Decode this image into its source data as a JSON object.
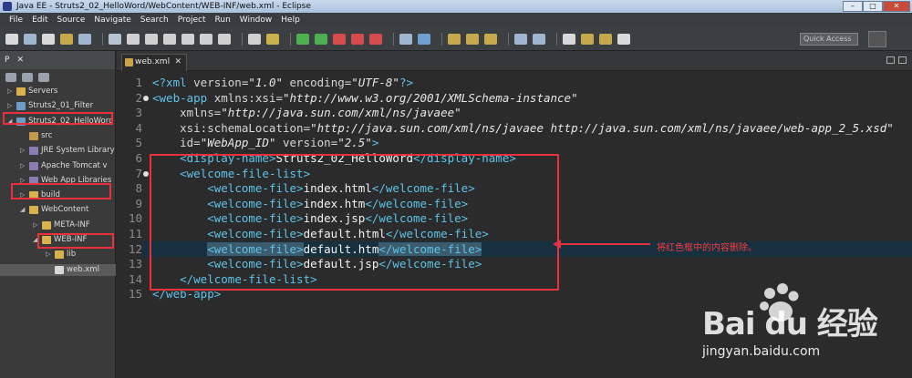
{
  "window": {
    "title": "Java EE - Struts2_02_HelloWord/WebContent/WEB-INF/web.xml - Eclipse",
    "controls": [
      "–",
      "□",
      "✕"
    ]
  },
  "menubar": [
    "File",
    "Edit",
    "Source",
    "Navigate",
    "Search",
    "Project",
    "Run",
    "Window",
    "Help"
  ],
  "toolbar": {
    "quick_access_placeholder": "Quick Access"
  },
  "left_panel": {
    "tabs": [
      "P",
      "✕"
    ],
    "tree": [
      {
        "label": "Servers",
        "depth": 0,
        "expanded": false,
        "icon": "folder",
        "color": "#d9b24b"
      },
      {
        "label": "Struts2_01_Filter",
        "depth": 0,
        "expanded": false,
        "icon": "project",
        "color": "#6d9cc7"
      },
      {
        "label": "Struts2_02_HelloWord",
        "depth": 0,
        "expanded": true,
        "icon": "project",
        "color": "#6d9cc7"
      },
      {
        "label": "src",
        "depth": 1,
        "expanded": null,
        "icon": "package",
        "color": "#c79a4a"
      },
      {
        "label": "JRE System Library",
        "depth": 1,
        "expanded": false,
        "icon": "library",
        "color": "#8c7bb5"
      },
      {
        "label": "Apache Tomcat v",
        "depth": 1,
        "expanded": false,
        "icon": "library",
        "color": "#8c7bb5"
      },
      {
        "label": "Web App Libraries",
        "depth": 1,
        "expanded": false,
        "icon": "library",
        "color": "#8c7bb5"
      },
      {
        "label": "build",
        "depth": 1,
        "expanded": false,
        "icon": "folder",
        "color": "#d9b24b"
      },
      {
        "label": "WebContent",
        "depth": 1,
        "expanded": true,
        "icon": "folder",
        "color": "#d9b24b"
      },
      {
        "label": "META-INF",
        "depth": 2,
        "expanded": false,
        "icon": "folder",
        "color": "#d9b24b"
      },
      {
        "label": "WEB-INF",
        "depth": 2,
        "expanded": true,
        "icon": "folder",
        "color": "#d9b24b"
      },
      {
        "label": "lib",
        "depth": 3,
        "expanded": false,
        "icon": "folder",
        "color": "#d9b24b"
      },
      {
        "label": "web.xml",
        "depth": 3,
        "expanded": null,
        "icon": "xml-file",
        "color": "#d8d8d8",
        "selected": true
      }
    ]
  },
  "editor": {
    "tab_label": "web.xml",
    "current_line": 12,
    "lines": [
      {
        "n": "1",
        "fold": false,
        "parts": [
          [
            "pi",
            "<?xml "
          ],
          [
            "attr",
            "version="
          ],
          [
            "str",
            "\"1.0\""
          ],
          [
            "attr",
            " encoding="
          ],
          [
            "str",
            "\"UTF-8\""
          ],
          [
            "pi",
            "?>"
          ]
        ]
      },
      {
        "n": "2",
        "fold": true,
        "parts": [
          [
            "tag",
            "<web-app "
          ],
          [
            "attr",
            "xmlns:xsi="
          ],
          [
            "str",
            "\"http://www.w3.org/2001/XMLSchema-instance\""
          ]
        ]
      },
      {
        "n": "3",
        "fold": false,
        "parts": [
          [
            "attr",
            "    xmlns="
          ],
          [
            "str",
            "\"http://java.sun.com/xml/ns/javaee\""
          ]
        ]
      },
      {
        "n": "4",
        "fold": false,
        "parts": [
          [
            "attr",
            "    xsi:schemaLocation="
          ],
          [
            "str",
            "\"http://java.sun.com/xml/ns/javaee http://java.sun.com/xml/ns/javaee/web-app_2_5.xsd\""
          ]
        ]
      },
      {
        "n": "5",
        "fold": false,
        "parts": [
          [
            "attr",
            "    id="
          ],
          [
            "str",
            "\"WebApp_ID\""
          ],
          [
            "attr",
            " version="
          ],
          [
            "str",
            "\"2.5\""
          ],
          [
            "tag",
            ">"
          ]
        ]
      },
      {
        "n": "6",
        "fold": false,
        "parts": [
          [
            "txt",
            "    "
          ],
          [
            "tag",
            "<display-name>"
          ],
          [
            "txt",
            "Struts2_02_HelloWord"
          ],
          [
            "tag",
            "</display-name>"
          ]
        ]
      },
      {
        "n": "7",
        "fold": true,
        "parts": [
          [
            "txt",
            "    "
          ],
          [
            "tag",
            "<welcome-file-list>"
          ]
        ]
      },
      {
        "n": "8",
        "fold": false,
        "parts": [
          [
            "txt",
            "        "
          ],
          [
            "tag",
            "<welcome-file>"
          ],
          [
            "txt",
            "index.html"
          ],
          [
            "tag",
            "</welcome-file>"
          ]
        ]
      },
      {
        "n": "9",
        "fold": false,
        "parts": [
          [
            "txt",
            "        "
          ],
          [
            "tag",
            "<welcome-file>"
          ],
          [
            "txt",
            "index.htm"
          ],
          [
            "tag",
            "</welcome-file>"
          ]
        ]
      },
      {
        "n": "10",
        "fold": false,
        "parts": [
          [
            "txt",
            "        "
          ],
          [
            "tag",
            "<welcome-file>"
          ],
          [
            "txt",
            "index.jsp"
          ],
          [
            "tag",
            "</welcome-file>"
          ]
        ]
      },
      {
        "n": "11",
        "fold": false,
        "parts": [
          [
            "txt",
            "        "
          ],
          [
            "tag",
            "<welcome-file>"
          ],
          [
            "txt",
            "default.html"
          ],
          [
            "tag",
            "</welcome-file>"
          ]
        ]
      },
      {
        "n": "12",
        "fold": false,
        "parts": [
          [
            "txt",
            "        "
          ],
          [
            "hltag",
            "<welcome-file>"
          ],
          [
            "txt",
            "default.htm"
          ],
          [
            "hltag",
            "</welcome-file>"
          ]
        ]
      },
      {
        "n": "13",
        "fold": false,
        "parts": [
          [
            "txt",
            "        "
          ],
          [
            "tag",
            "<welcome-file>"
          ],
          [
            "txt",
            "default.jsp"
          ],
          [
            "tag",
            "</welcome-file>"
          ]
        ]
      },
      {
        "n": "14",
        "fold": false,
        "parts": [
          [
            "txt",
            "    "
          ],
          [
            "tag",
            "</welcome-file-list>"
          ]
        ]
      },
      {
        "n": "15",
        "fold": false,
        "parts": [
          [
            "tag",
            "</web-app>"
          ]
        ]
      }
    ]
  },
  "annotation": {
    "note": "将红色框中的内容删除。",
    "color": "#e8313a"
  },
  "watermark": {
    "brand": "Bai du 经验",
    "url": "jingyan.baidu.com"
  }
}
